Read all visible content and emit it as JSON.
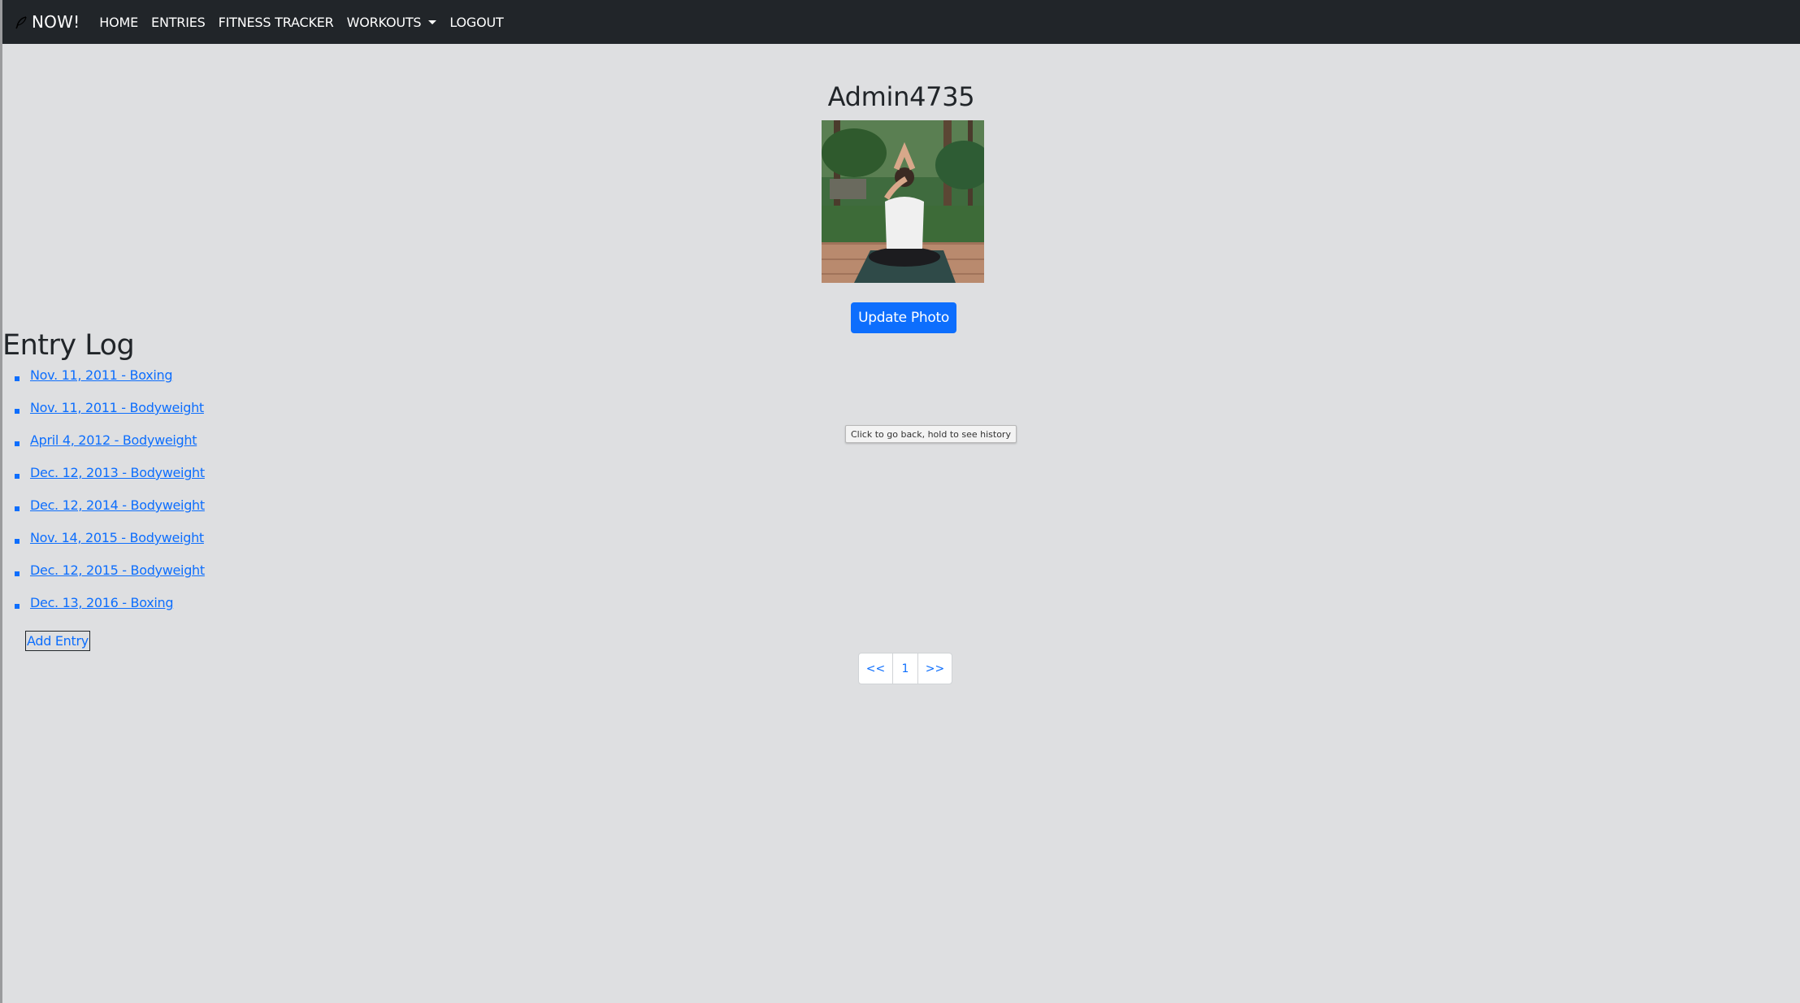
{
  "navbar": {
    "brand": "NOW!",
    "brand_icon": "feather-icon",
    "links": {
      "home": "HOME",
      "entries": "ENTRIES",
      "fitness_tracker": "FITNESS TRACKER",
      "workouts": "WORKOUTS",
      "logout": "LOGOUT"
    },
    "background": "#212529"
  },
  "profile": {
    "username": "Admin4735",
    "photo": "profile-photo",
    "update_button": "Update Photo"
  },
  "entry_log": {
    "title": "Entry Log",
    "entries": [
      "Nov. 11, 2011 - Boxing",
      "Nov. 11, 2011 - Bodyweight",
      "April 4, 2012 - Bodyweight",
      "Dec. 12, 2013 - Bodyweight",
      "Dec. 12, 2014 - Bodyweight",
      "Nov. 14, 2015 - Bodyweight",
      "Dec. 12, 2015 - Bodyweight",
      "Dec. 13, 2016 - Boxing"
    ],
    "add_entry": "Add Entry"
  },
  "tooltip": {
    "text": "Click to go back, hold to see history"
  },
  "pagination": {
    "prev": "<<",
    "current": "1",
    "next": ">>"
  },
  "colors": {
    "accent": "#0d6efd",
    "page_bg": "#dedfe1",
    "text": "#212529"
  }
}
